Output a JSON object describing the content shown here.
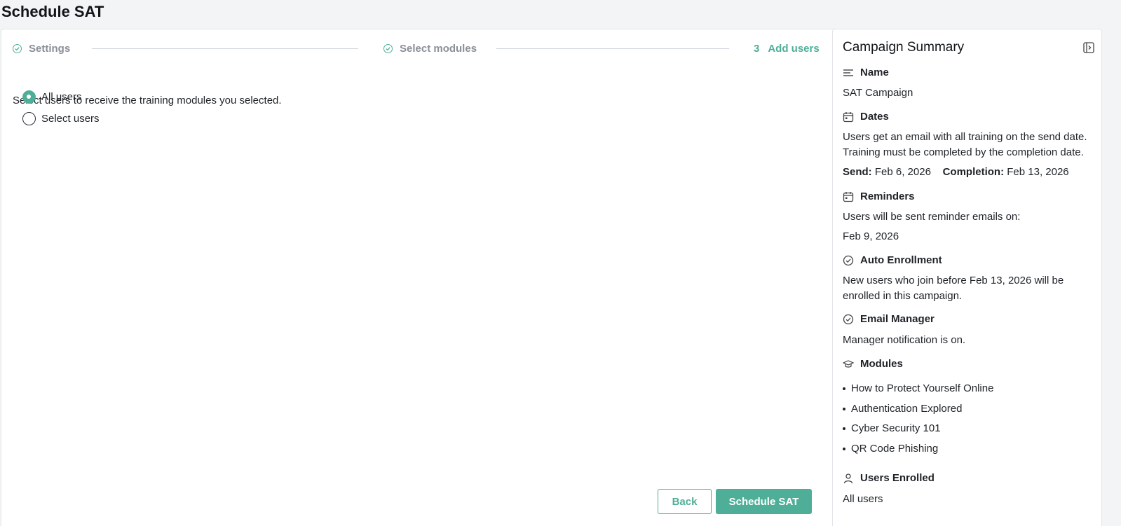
{
  "page": {
    "title": "Schedule SAT"
  },
  "stepper": {
    "steps": [
      {
        "label": "Settings",
        "state": "done"
      },
      {
        "label": "Select modules",
        "state": "done"
      },
      {
        "number": "3",
        "label": "Add users",
        "state": "current"
      }
    ]
  },
  "main": {
    "instruction": "Select users to receive the training modules you selected.",
    "options": [
      {
        "label": "All users",
        "checked": true
      },
      {
        "label": "Select users",
        "checked": false
      }
    ],
    "back_label": "Back",
    "submit_label": "Schedule SAT"
  },
  "summary": {
    "title": "Campaign Summary",
    "name": {
      "heading": "Name",
      "value": "SAT Campaign"
    },
    "dates": {
      "heading": "Dates",
      "text": "Users get an email with all training on the send date. Training must be completed by the completion date.",
      "send_label": "Send:",
      "send_value": "Feb 6, 2026",
      "completion_label": "Completion:",
      "completion_value": "Feb 13, 2026"
    },
    "reminders": {
      "heading": "Reminders",
      "text": "Users will be sent reminder emails on:",
      "date": "Feb 9, 2026"
    },
    "auto_enrollment": {
      "heading": "Auto Enrollment",
      "text": "New users who join before Feb 13, 2026 will be enrolled in this campaign."
    },
    "email_manager": {
      "heading": "Email Manager",
      "text": "Manager notification is on."
    },
    "modules": {
      "heading": "Modules",
      "items": [
        "How to Protect Yourself Online",
        "Authentication Explored",
        "Cyber Security 101",
        "QR Code Phishing"
      ]
    },
    "users_enrolled": {
      "heading": "Users Enrolled",
      "value": "All users"
    }
  },
  "colors": {
    "accent": "#4eae97",
    "background": "#f3f4f6",
    "panel": "#ffffff"
  }
}
